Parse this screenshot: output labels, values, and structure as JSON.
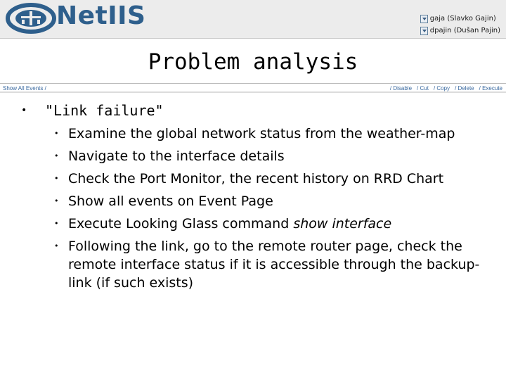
{
  "header": {
    "logo_text": "NetIIS",
    "users": [
      {
        "label": "gaja (Slavko Gajin)"
      },
      {
        "label": "dpajin (Dušan Pajin)"
      }
    ],
    "brand_color": "#2e5f8c"
  },
  "page": {
    "title": "Problem analysis"
  },
  "toolbar": {
    "breadcrumb": "Show All Events /",
    "actions": [
      {
        "label": "/ Disable"
      },
      {
        "label": "/ Cut"
      },
      {
        "label": "/ Copy"
      },
      {
        "label": "/ Delete"
      },
      {
        "label": "/ Execute"
      }
    ],
    "link_color": "#3b6aa0"
  },
  "content": {
    "topic": "\"Link failure\"",
    "steps": [
      {
        "text": "Examine the global network status from the weather-map"
      },
      {
        "text": "Navigate to the interface details"
      },
      {
        "text": "Check the Port Monitor, the recent history on RRD Chart"
      },
      {
        "text": "Show all events on Event Page"
      },
      {
        "text": "Execute Looking Glass command ",
        "emphasis": "show interface"
      },
      {
        "text": "Following the link, go to the remote router page, check the remote interface status if it is accessible through the backup-link (if such exists)"
      }
    ]
  }
}
